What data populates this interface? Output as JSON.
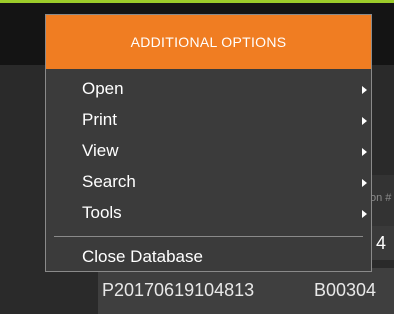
{
  "background": {
    "column_label": "on #",
    "top_row_value": "4",
    "row_id": "P20170619104813",
    "row_code": "B00304"
  },
  "menu": {
    "title": "ADDITIONAL OPTIONS",
    "items": [
      {
        "label": "Open"
      },
      {
        "label": "Print"
      },
      {
        "label": "View"
      },
      {
        "label": "Search"
      },
      {
        "label": "Tools"
      }
    ],
    "close_label": "Close Database"
  },
  "colors": {
    "accent": "#f07d22",
    "top_line": "#9ccc2a",
    "menu_bg": "#3b3b3b"
  }
}
